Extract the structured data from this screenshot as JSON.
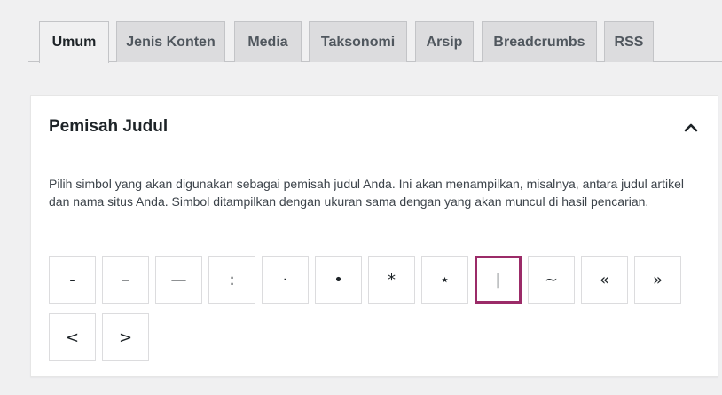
{
  "tabs": [
    {
      "label": "Umum",
      "active": true
    },
    {
      "label": "Jenis Konten",
      "active": false
    },
    {
      "label": "Media",
      "active": false
    },
    {
      "label": "Taksonomi",
      "active": false
    },
    {
      "label": "Arsip",
      "active": false
    },
    {
      "label": "Breadcrumbs",
      "active": false
    },
    {
      "label": "RSS",
      "active": false
    }
  ],
  "panel": {
    "title": "Pemisah Judul",
    "toggle_icon": "chevron-up-icon",
    "description": "Pilih simbol yang akan digunakan sebagai pemisah judul Anda. Ini akan menampilkan, misalnya, antara judul artikel dan nama situs Anda. Simbol ditampilkan dengan ukuran sama dengan yang akan muncul di hasil pencarian."
  },
  "separators": [
    {
      "symbol": "-",
      "selected": false
    },
    {
      "symbol": "–",
      "selected": false
    },
    {
      "symbol": "—",
      "selected": false
    },
    {
      "symbol": ":",
      "selected": false
    },
    {
      "symbol": "·",
      "selected": false
    },
    {
      "symbol": "•",
      "selected": false
    },
    {
      "symbol": "*",
      "selected": false
    },
    {
      "symbol": "⋆",
      "selected": false
    },
    {
      "symbol": "|",
      "selected": true
    },
    {
      "symbol": "~",
      "selected": false
    },
    {
      "symbol": "«",
      "selected": false
    },
    {
      "symbol": "»",
      "selected": false
    },
    {
      "symbol": "<",
      "selected": false
    },
    {
      "symbol": ">",
      "selected": false
    }
  ],
  "colors": {
    "selected_border": "#9b2b68",
    "page_background": "#f0f0f1",
    "tab_inactive": "#dcdcde"
  }
}
